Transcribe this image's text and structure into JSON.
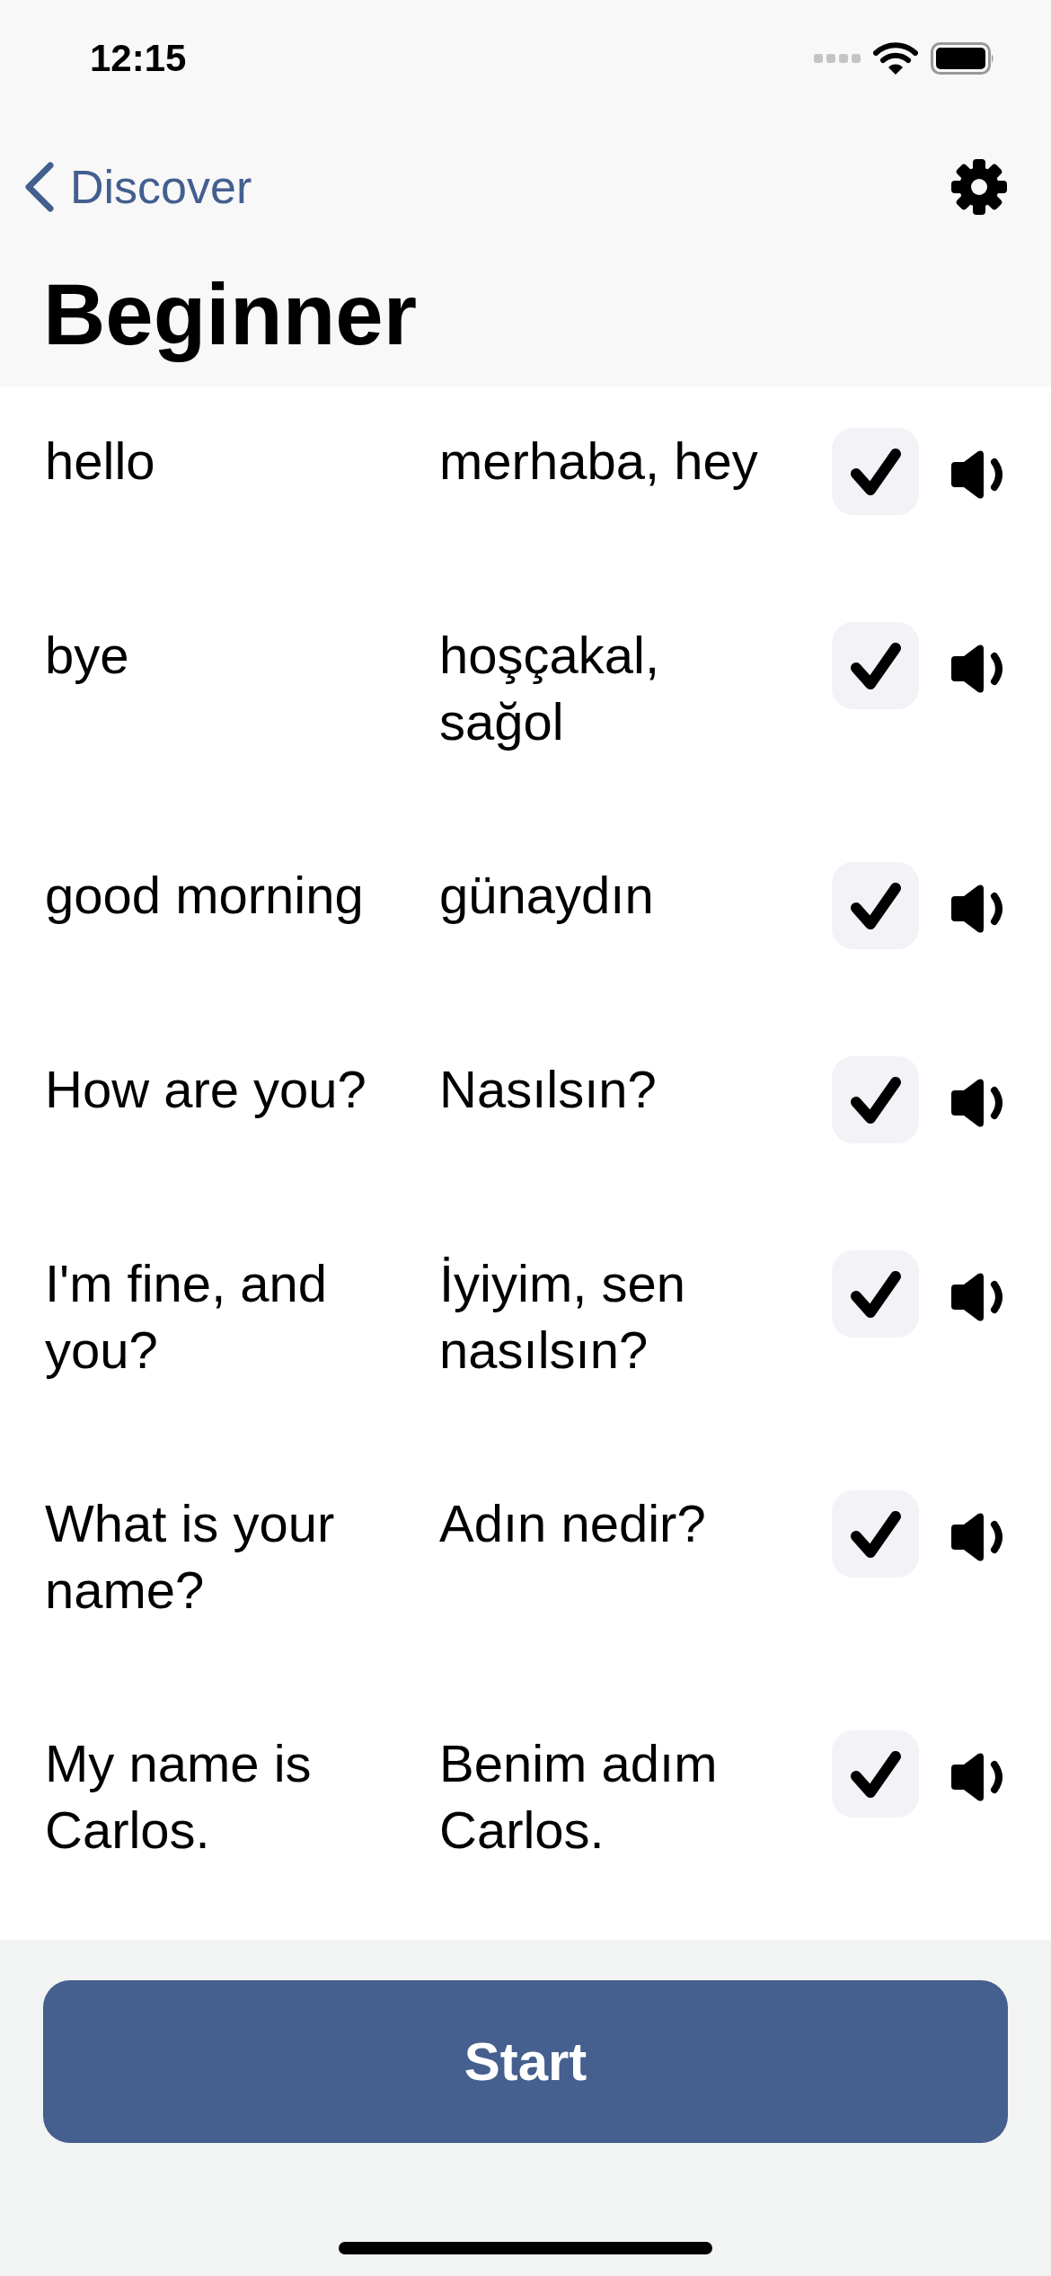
{
  "status_bar": {
    "time": "12:15"
  },
  "nav": {
    "back_label": "Discover",
    "title": "Beginner"
  },
  "phrases": [
    {
      "english": "hello",
      "translation": "merhaba, hey",
      "checked": true
    },
    {
      "english": "bye",
      "translation": "hoşçakal, sağol",
      "checked": true
    },
    {
      "english": "good morning",
      "translation": "günaydın",
      "checked": true
    },
    {
      "english": "How are you?",
      "translation": "Nasılsın?",
      "checked": true
    },
    {
      "english": "I'm fine, and you?",
      "translation": "İyiyim, sen nasılsın?",
      "checked": true
    },
    {
      "english": "What is your name?",
      "translation": "Adın nedir?",
      "checked": true
    },
    {
      "english": "My name is Carlos.",
      "translation": "Benim adım Carlos.",
      "checked": true
    }
  ],
  "start_button": {
    "label": "Start"
  }
}
